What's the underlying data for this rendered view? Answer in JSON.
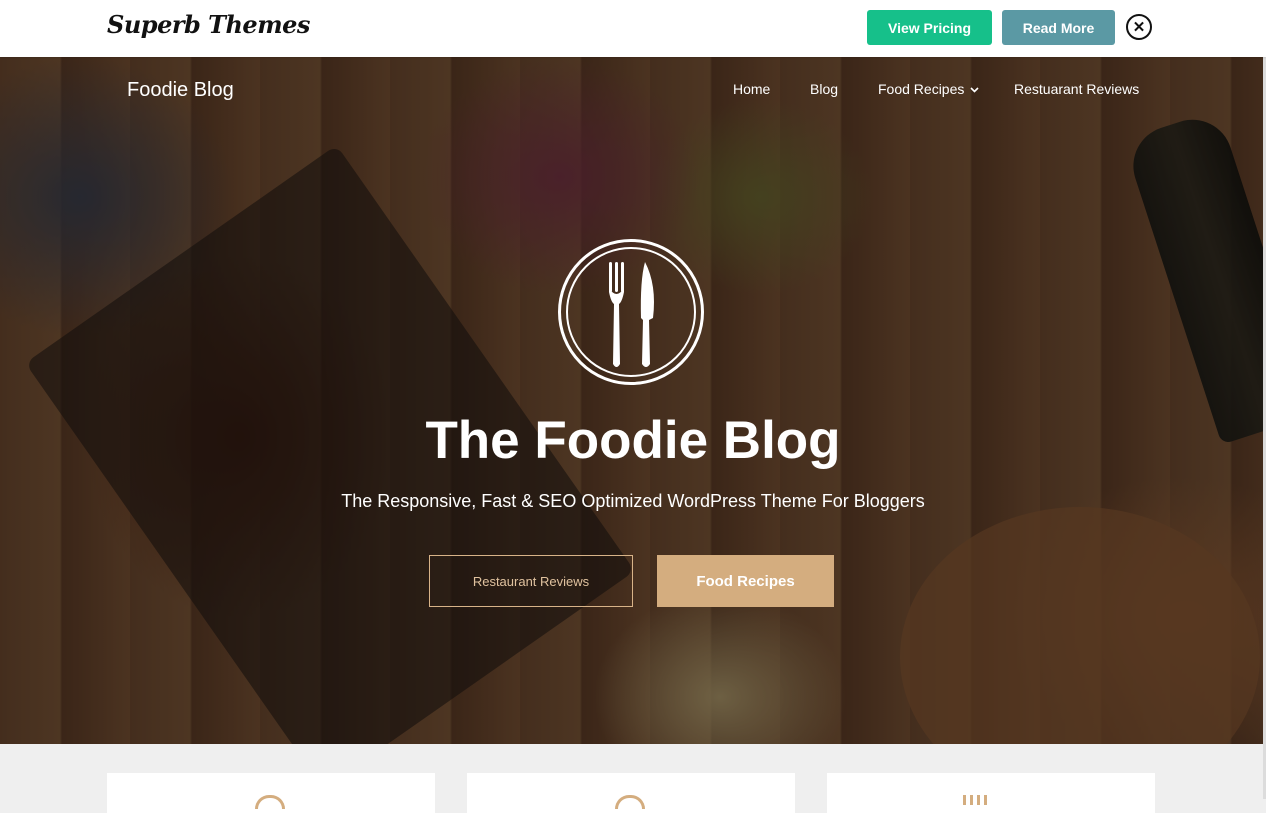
{
  "topbar": {
    "brand": "Superb Themes",
    "view_pricing_label": "View Pricing",
    "read_more_label": "Read More",
    "close_icon": "close-circle-icon",
    "colors": {
      "view_pricing": "#16c08a",
      "read_more": "#5b99a4"
    }
  },
  "site": {
    "title": "Foodie Blog",
    "nav": [
      {
        "label": "Home"
      },
      {
        "label": "Blog"
      },
      {
        "label": "Food Recipes",
        "icon": "chevron-down-icon"
      },
      {
        "label": "Restuarant Reviews"
      }
    ]
  },
  "hero": {
    "logo_icon": "fork-knife-icon",
    "title": "The Foodie Blog",
    "subtitle": "The Responsive, Fast & SEO Optimized WordPress Theme For Bloggers",
    "primary_button": "Restaurant Reviews",
    "secondary_button": "Food Recipes",
    "accent_color": "#d4ad7f"
  }
}
